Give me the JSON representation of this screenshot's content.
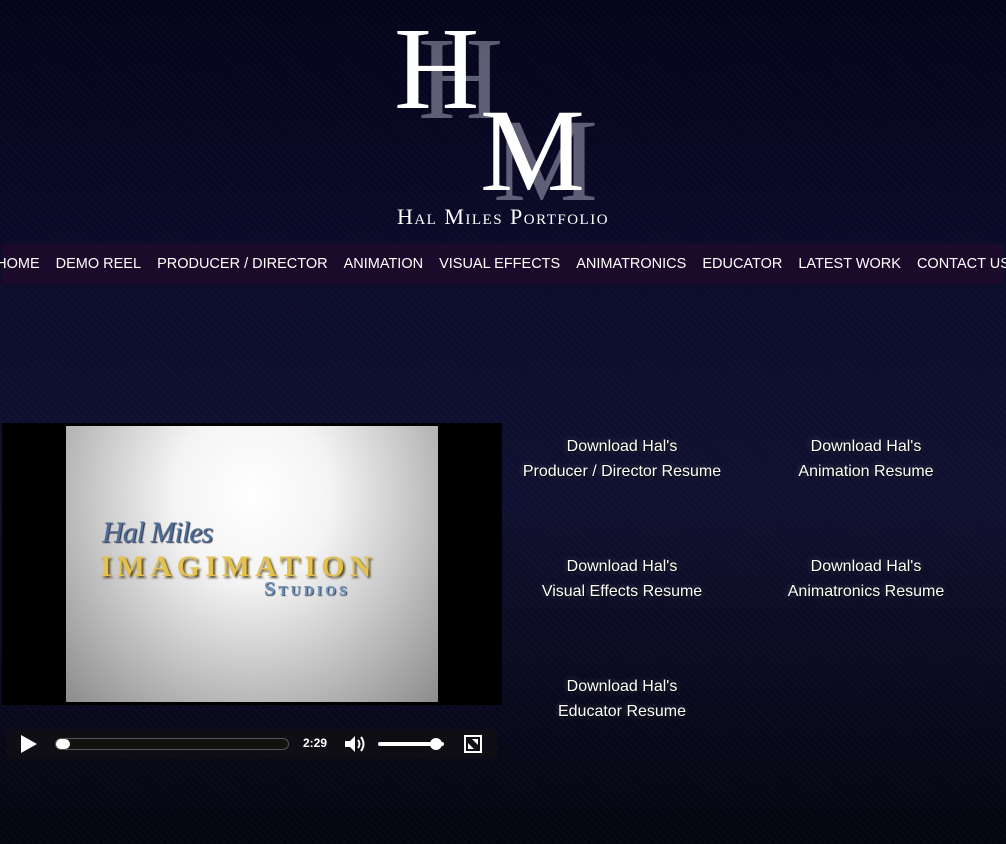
{
  "logo": {
    "letter_h": "H",
    "letter_m": "M",
    "subtitle": "Hal Miles Portfolio"
  },
  "nav": {
    "items": [
      {
        "label": "HOME"
      },
      {
        "label": "DEMO REEL"
      },
      {
        "label": "PRODUCER / DIRECTOR"
      },
      {
        "label": "ANIMATION"
      },
      {
        "label": "VISUAL EFFECTS"
      },
      {
        "label": "ANIMATRONICS"
      },
      {
        "label": "EDUCATOR"
      },
      {
        "label": "LATEST WORK"
      },
      {
        "label": "CONTACT US"
      }
    ]
  },
  "video": {
    "frame_line1": "Hal Miles",
    "frame_line2": "IMAGIMATION",
    "frame_line3": "Studios",
    "duration": "2:29",
    "progress_fraction": 0.04,
    "volume_fraction": 0.88
  },
  "resumes": [
    {
      "line1": "Download Hal's",
      "line2": "Producer / Director Resume"
    },
    {
      "line1": "Download Hal's",
      "line2": "Animation Resume"
    },
    {
      "line1": "Download Hal's",
      "line2": "Visual Effects Resume"
    },
    {
      "line1": "Download Hal's",
      "line2": "Animatronics Resume"
    },
    {
      "line1": "Download Hal's",
      "line2": "Educator Resume"
    }
  ],
  "colors": {
    "nav_background": "#1c0a2a",
    "page_background": "#0b0b2a"
  }
}
